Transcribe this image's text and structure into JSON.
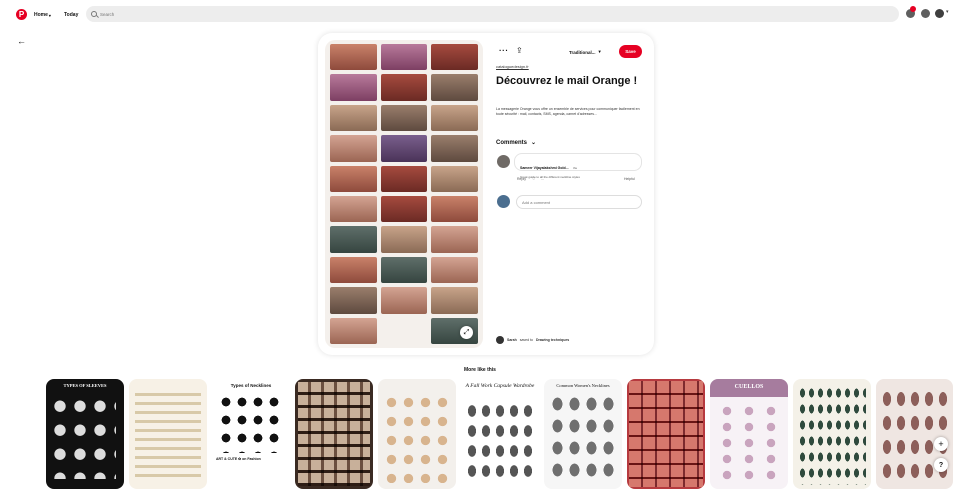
{
  "nav": {
    "home_label": "Home",
    "today_label": "Today",
    "search_placeholder": "Search",
    "colors": {
      "brand": "#e60023"
    }
  },
  "pin": {
    "board_label": "Traditional...",
    "save_label": "Save",
    "source": "cataloguedesign.fr",
    "title": "Découvrez le mail Orange !",
    "description": "La messagerie Orange vous offre un ensemble de services pour communiquer facilement en toute sécurité : mail, contacts, SMS, agenda, carnet d'adresses...",
    "comments_header": "Comments",
    "comment": {
      "author": "Sameer Vijayalakshmi Gold...",
      "age": "3w",
      "text": "Great guide to all the different neckline styles",
      "actions": [
        "Reply",
        "♡",
        "..."
      ],
      "helpful": "Helpful"
    },
    "add_comment_placeholder": "Add a comment",
    "saved_by": {
      "user": "Sarah",
      "verb": "saved to",
      "board": "Drawing techniques"
    }
  },
  "more_like_this": {
    "header": "More like this",
    "tiles": [
      {
        "title": "TYPES OF SLEEVES"
      },
      {
        "title": ""
      },
      {
        "title": "Types of Necklines",
        "footer": "ART & CUTE ✿ on Fashion"
      },
      {
        "title": ""
      },
      {
        "title": ""
      },
      {
        "title": "A Fall Work Capsule Wardrobe"
      },
      {
        "title": "Common Women's Necklines"
      },
      {
        "title": ""
      },
      {
        "title": "CUELLOS"
      },
      {
        "title": ""
      },
      {
        "title": ""
      }
    ]
  },
  "icons": {
    "logo": "pinterest-logo-icon",
    "back": "arrow-left-icon",
    "more": "ellipsis-icon",
    "share": "share-icon",
    "expand": "expand-icon",
    "plus": "plus-icon",
    "help": "question-icon"
  }
}
